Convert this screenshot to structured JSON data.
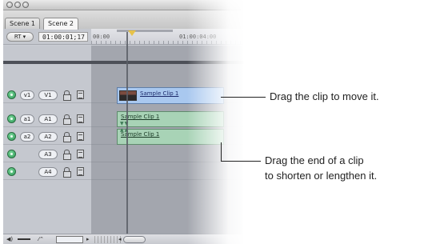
{
  "window": {
    "tabs": [
      "Scene 1",
      "Scene 2"
    ],
    "active_tab": "Scene 2"
  },
  "controls": {
    "rt_label": "RT ▾",
    "timecode": "01:00:01;17"
  },
  "ruler": {
    "start_label": "00:00",
    "mid_label": "01:00:04:00"
  },
  "tracks": [
    {
      "source": "v1",
      "destination": "V1"
    },
    {
      "source": "a1",
      "destination": "A1"
    },
    {
      "source": "a2",
      "destination": "A2"
    },
    {
      "source": "",
      "destination": "A3"
    },
    {
      "source": "",
      "destination": "A4"
    }
  ],
  "clips": {
    "video": "Sample Clip 1",
    "audio1": "Sample Clip 1",
    "audio2": "Sample Clip 1"
  },
  "callouts": {
    "move": "Drag the clip to move it.",
    "trim_line1": "Drag the end of a clip",
    "trim_line2": "to shorten or lengthen it."
  },
  "colors": {
    "video_clip": "#a9c8ef",
    "audio_clip": "#a8d3b6",
    "playhead": "#e7c24a"
  }
}
